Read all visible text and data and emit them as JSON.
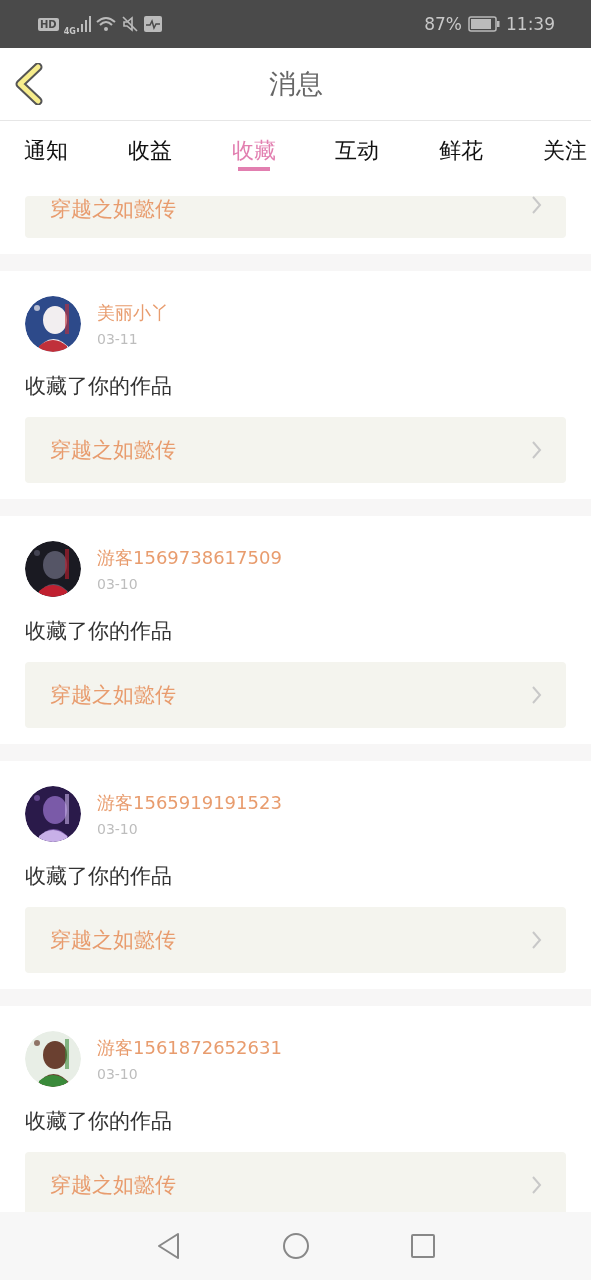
{
  "status_bar": {
    "hd_badge": "HD",
    "network": "4G",
    "battery_percent": "87%",
    "time": "11:39"
  },
  "header": {
    "title": "消息"
  },
  "tabs": [
    {
      "label": "通知",
      "selected": false
    },
    {
      "label": "收益",
      "selected": false
    },
    {
      "label": "收藏",
      "selected": true
    },
    {
      "label": "互动",
      "selected": false
    },
    {
      "label": "鲜花",
      "selected": false
    },
    {
      "label": "关注",
      "selected": false
    }
  ],
  "partial_item": {
    "work": "穿越之如懿传"
  },
  "items": [
    {
      "user": "美丽小丫",
      "date": "03-11",
      "action": "收藏了你的作品",
      "work": "穿越之如懿传"
    },
    {
      "user": "游客1569738617509",
      "date": "03-10",
      "action": "收藏了你的作品",
      "work": "穿越之如懿传"
    },
    {
      "user": "游客1565919191523",
      "date": "03-10",
      "action": "收藏了你的作品",
      "work": "穿越之如懿传"
    },
    {
      "user": "游客1561872652631",
      "date": "03-10",
      "action": "收藏了你的作品",
      "work": "穿越之如懿传"
    }
  ]
}
